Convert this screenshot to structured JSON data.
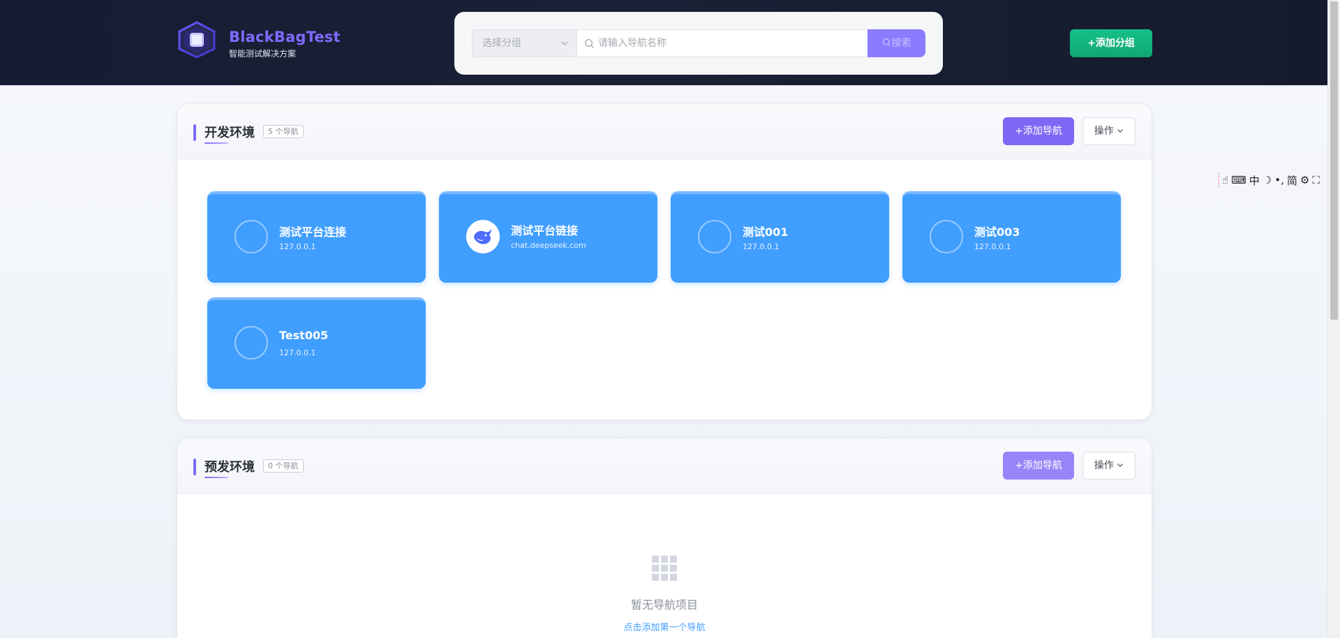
{
  "header": {
    "brand_name": "BlackBagTest",
    "brand_subtitle": "智能测试解决方案",
    "group_select_placeholder": "选择分组",
    "search_placeholder": "请输入导航名称",
    "search_button": "搜索",
    "add_group_button": "+添加分组"
  },
  "ime_toolbar": {
    "lang": "中",
    "mode": "简"
  },
  "sections": [
    {
      "title": "开发环境",
      "count": "5 个导航",
      "add_nav_button": "+添加导航",
      "ops_button": "操作",
      "cards": [
        {
          "title": "测试平台连接",
          "url": "127.0.0.1"
        },
        {
          "title": "测试平台链接",
          "url": "chat.deepseek.com"
        },
        {
          "title": "测试001",
          "url": "127.0.0.1"
        },
        {
          "title": "测试003",
          "url": "127.0.0.1"
        },
        {
          "title": "Test005",
          "url": "127.0.0.1"
        }
      ]
    },
    {
      "title": "预发环境",
      "count": "0 个导航",
      "add_nav_button": "+添加导航",
      "ops_button": "操作",
      "empty_text": "暂无导航项目",
      "empty_link": "点击添加第一个导航"
    }
  ],
  "colors": {
    "accent": "#7d68f5",
    "card_blue": "#409eff",
    "success": "#13b57f",
    "header_bg": "#161c33"
  }
}
